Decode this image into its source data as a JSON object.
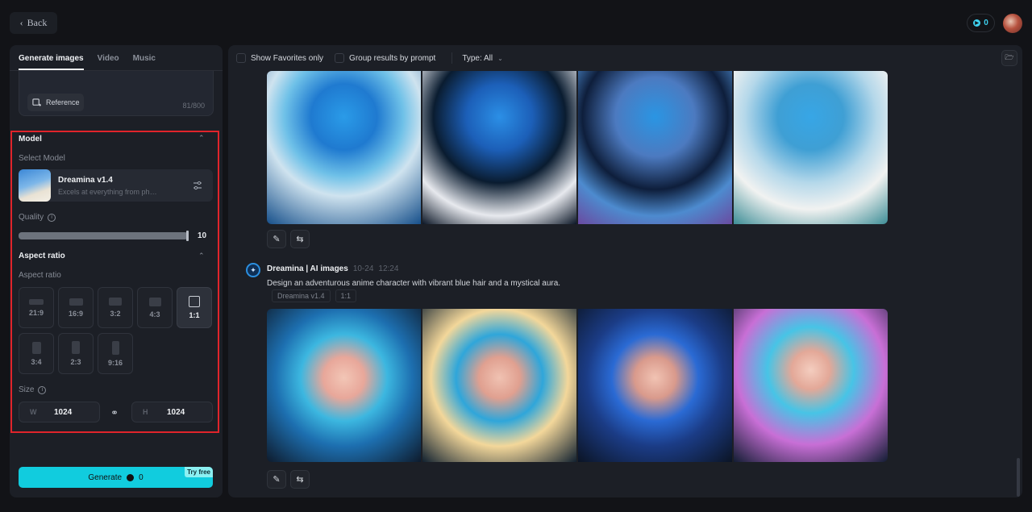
{
  "header": {
    "back_label": "Back",
    "credits": "0"
  },
  "left_panel": {
    "tabs": [
      {
        "label": "Generate images",
        "active": true
      },
      {
        "label": "Video",
        "active": false
      },
      {
        "label": "Music",
        "active": false
      }
    ],
    "prompt": {
      "reference_label": "Reference",
      "char_count": "81/800"
    },
    "model_section": {
      "title": "Model",
      "select_label": "Select Model",
      "model_name": "Dreamina v1.4",
      "model_desc": "Excels at everything from photorealism to painterly styles"
    },
    "quality": {
      "label": "Quality",
      "value": "10",
      "fraction": 1.0
    },
    "aspect_section": {
      "title": "Aspect ratio",
      "subtitle": "Aspect ratio",
      "options": [
        "21:9",
        "16:9",
        "3:2",
        "4:3",
        "1:1",
        "3:4",
        "2:3",
        "9:16"
      ],
      "selected": "1:1"
    },
    "size": {
      "label": "Size",
      "width_prefix": "W",
      "width": "1024",
      "height_prefix": "H",
      "height": "1024"
    },
    "generate": {
      "label": "Generate",
      "cost": "0",
      "badge": "Try free"
    }
  },
  "right_panel": {
    "toolbar": {
      "favorites_label": "Show Favorites only",
      "group_label": "Group results by prompt",
      "type_label": "Type: All"
    },
    "message": {
      "author": "Dreamina | AI images",
      "date": "10-24",
      "time": "12:24",
      "prompt": "Design an adventurous anime character with vibrant blue hair and a mystical aura.",
      "tags": [
        "Dreamina v1.4",
        "1:1"
      ]
    },
    "colors": {
      "accent": "#11ccde",
      "highlight": "#e0242b"
    }
  }
}
